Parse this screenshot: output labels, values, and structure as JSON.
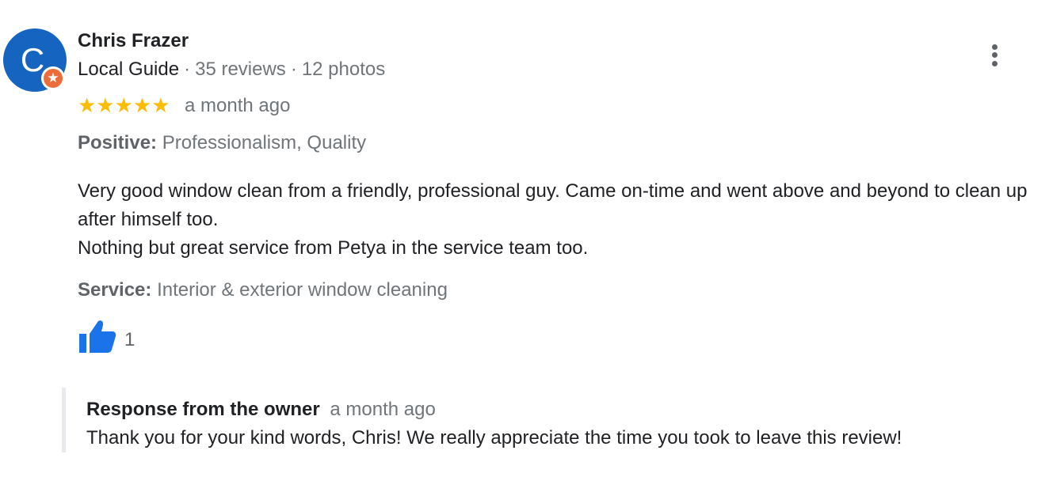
{
  "review": {
    "author": {
      "initial": "C",
      "name": "Chris Frazer",
      "badge": "Local Guide",
      "reviews": "35 reviews",
      "photos": "12 photos",
      "separator": "·",
      "avatar_color": "#1565c0",
      "badge_icon": "star-icon"
    },
    "rating": {
      "stars": 5,
      "stars_glyph": "★★★★★",
      "star_color": "#fbbc04",
      "date": "a month ago"
    },
    "positive": {
      "label": "Positive:",
      "value": "Professionalism, Quality"
    },
    "text": {
      "paragraph1": "Very good window clean from a friendly, professional guy. Came on-time and went above and beyond to clean up after himself too.",
      "paragraph2": "Nothing but great service from Petya in the service team too."
    },
    "service": {
      "label": "Service:",
      "value": "Interior & exterior window cleaning"
    },
    "likes": {
      "count": "1",
      "icon": "thumbs-up-icon",
      "color": "#1a73e8"
    },
    "menu_icon": "more-vert-icon"
  },
  "owner_response": {
    "title": "Response from the owner",
    "date": "a month ago",
    "text": "Thank you for your kind words, Chris! We really appreciate the time you took to leave this review!"
  }
}
